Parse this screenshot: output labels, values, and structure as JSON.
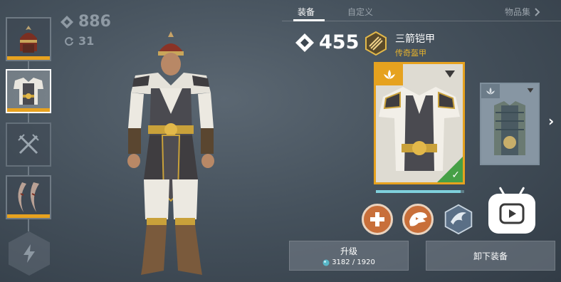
{
  "stats": {
    "power": "886",
    "level": "31"
  },
  "tabs": {
    "equip": "装备",
    "custom": "自定义",
    "collection": "物品集"
  },
  "item": {
    "power": "455",
    "name": "三箭铠甲",
    "rarity": "传奇盔甲"
  },
  "card_progress": 0.96,
  "buttons": {
    "upgrade_label": "升级",
    "upgrade_cost": "3182 / 1920",
    "unequip_label": "卸下装备"
  },
  "colors": {
    "rarity_gold": "#e6a21f",
    "equipped_green": "#46a046",
    "skill_orange": "#c86f3a"
  },
  "icons": {
    "power": "diamond-gem-icon",
    "level": "refresh-icon",
    "rarity": "arrows-emblem-icon",
    "magic": "lightning-icon",
    "video": "video-play-icon"
  }
}
